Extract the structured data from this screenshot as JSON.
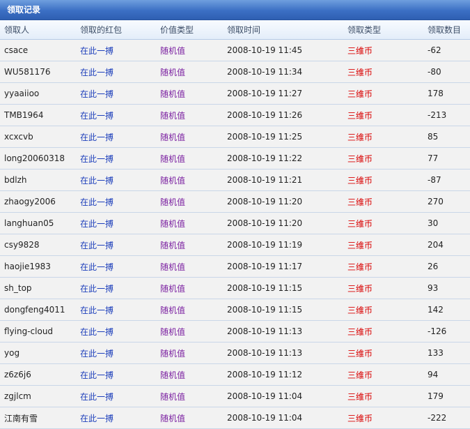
{
  "panel": {
    "title": "领取记录"
  },
  "columns": [
    "领取人",
    "领取的红包",
    "价值类型",
    "领取时间",
    "领取类型",
    "领取数目"
  ],
  "rows": [
    {
      "user": "csace",
      "packet": "在此一搏",
      "value_type": "随机值",
      "time": "2008-10-19 11:45",
      "claim_type": "三维币",
      "amount": "-62"
    },
    {
      "user": "WU581176",
      "packet": "在此一搏",
      "value_type": "随机值",
      "time": "2008-10-19 11:34",
      "claim_type": "三维币",
      "amount": "-80"
    },
    {
      "user": "yyaaiioo",
      "packet": "在此一搏",
      "value_type": "随机值",
      "time": "2008-10-19 11:27",
      "claim_type": "三维币",
      "amount": "178"
    },
    {
      "user": "TMB1964",
      "packet": "在此一搏",
      "value_type": "随机值",
      "time": "2008-10-19 11:26",
      "claim_type": "三维币",
      "amount": "-213"
    },
    {
      "user": "xcxcvb",
      "packet": "在此一搏",
      "value_type": "随机值",
      "time": "2008-10-19 11:25",
      "claim_type": "三维币",
      "amount": "85"
    },
    {
      "user": "long20060318",
      "packet": "在此一搏",
      "value_type": "随机值",
      "time": "2008-10-19 11:22",
      "claim_type": "三维币",
      "amount": "77"
    },
    {
      "user": "bdlzh",
      "packet": "在此一搏",
      "value_type": "随机值",
      "time": "2008-10-19 11:21",
      "claim_type": "三维币",
      "amount": "-87"
    },
    {
      "user": "zhaogy2006",
      "packet": "在此一搏",
      "value_type": "随机值",
      "time": "2008-10-19 11:20",
      "claim_type": "三维币",
      "amount": "270"
    },
    {
      "user": "langhuan05",
      "packet": "在此一搏",
      "value_type": "随机值",
      "time": "2008-10-19 11:20",
      "claim_type": "三维币",
      "amount": "30"
    },
    {
      "user": "csy9828",
      "packet": "在此一搏",
      "value_type": "随机值",
      "time": "2008-10-19 11:19",
      "claim_type": "三维币",
      "amount": "204"
    },
    {
      "user": "haojie1983",
      "packet": "在此一搏",
      "value_type": "随机值",
      "time": "2008-10-19 11:17",
      "claim_type": "三维币",
      "amount": "26"
    },
    {
      "user": "sh_top",
      "packet": "在此一搏",
      "value_type": "随机值",
      "time": "2008-10-19 11:15",
      "claim_type": "三维币",
      "amount": "93"
    },
    {
      "user": "dongfeng4011",
      "packet": "在此一搏",
      "value_type": "随机值",
      "time": "2008-10-19 11:15",
      "claim_type": "三维币",
      "amount": "142"
    },
    {
      "user": "flying-cloud",
      "packet": "在此一搏",
      "value_type": "随机值",
      "time": "2008-10-19 11:13",
      "claim_type": "三维币",
      "amount": "-126"
    },
    {
      "user": "yog",
      "packet": "在此一搏",
      "value_type": "随机值",
      "time": "2008-10-19 11:13",
      "claim_type": "三维币",
      "amount": "133"
    },
    {
      "user": "z6z6j6",
      "packet": "在此一搏",
      "value_type": "随机值",
      "time": "2008-10-19 11:12",
      "claim_type": "三维币",
      "amount": "94"
    },
    {
      "user": "zgjlcm",
      "packet": "在此一搏",
      "value_type": "随机值",
      "time": "2008-10-19 11:04",
      "claim_type": "三维币",
      "amount": "179"
    },
    {
      "user": "江南有雪",
      "packet": "在此一搏",
      "value_type": "随机值",
      "time": "2008-10-19 11:04",
      "claim_type": "三维币",
      "amount": "-222"
    }
  ],
  "colors": {
    "title_bar": "#3b6fc4",
    "link": "#1d3fbb",
    "value_type": "#7a1fa0",
    "claim_type": "#d90000"
  }
}
